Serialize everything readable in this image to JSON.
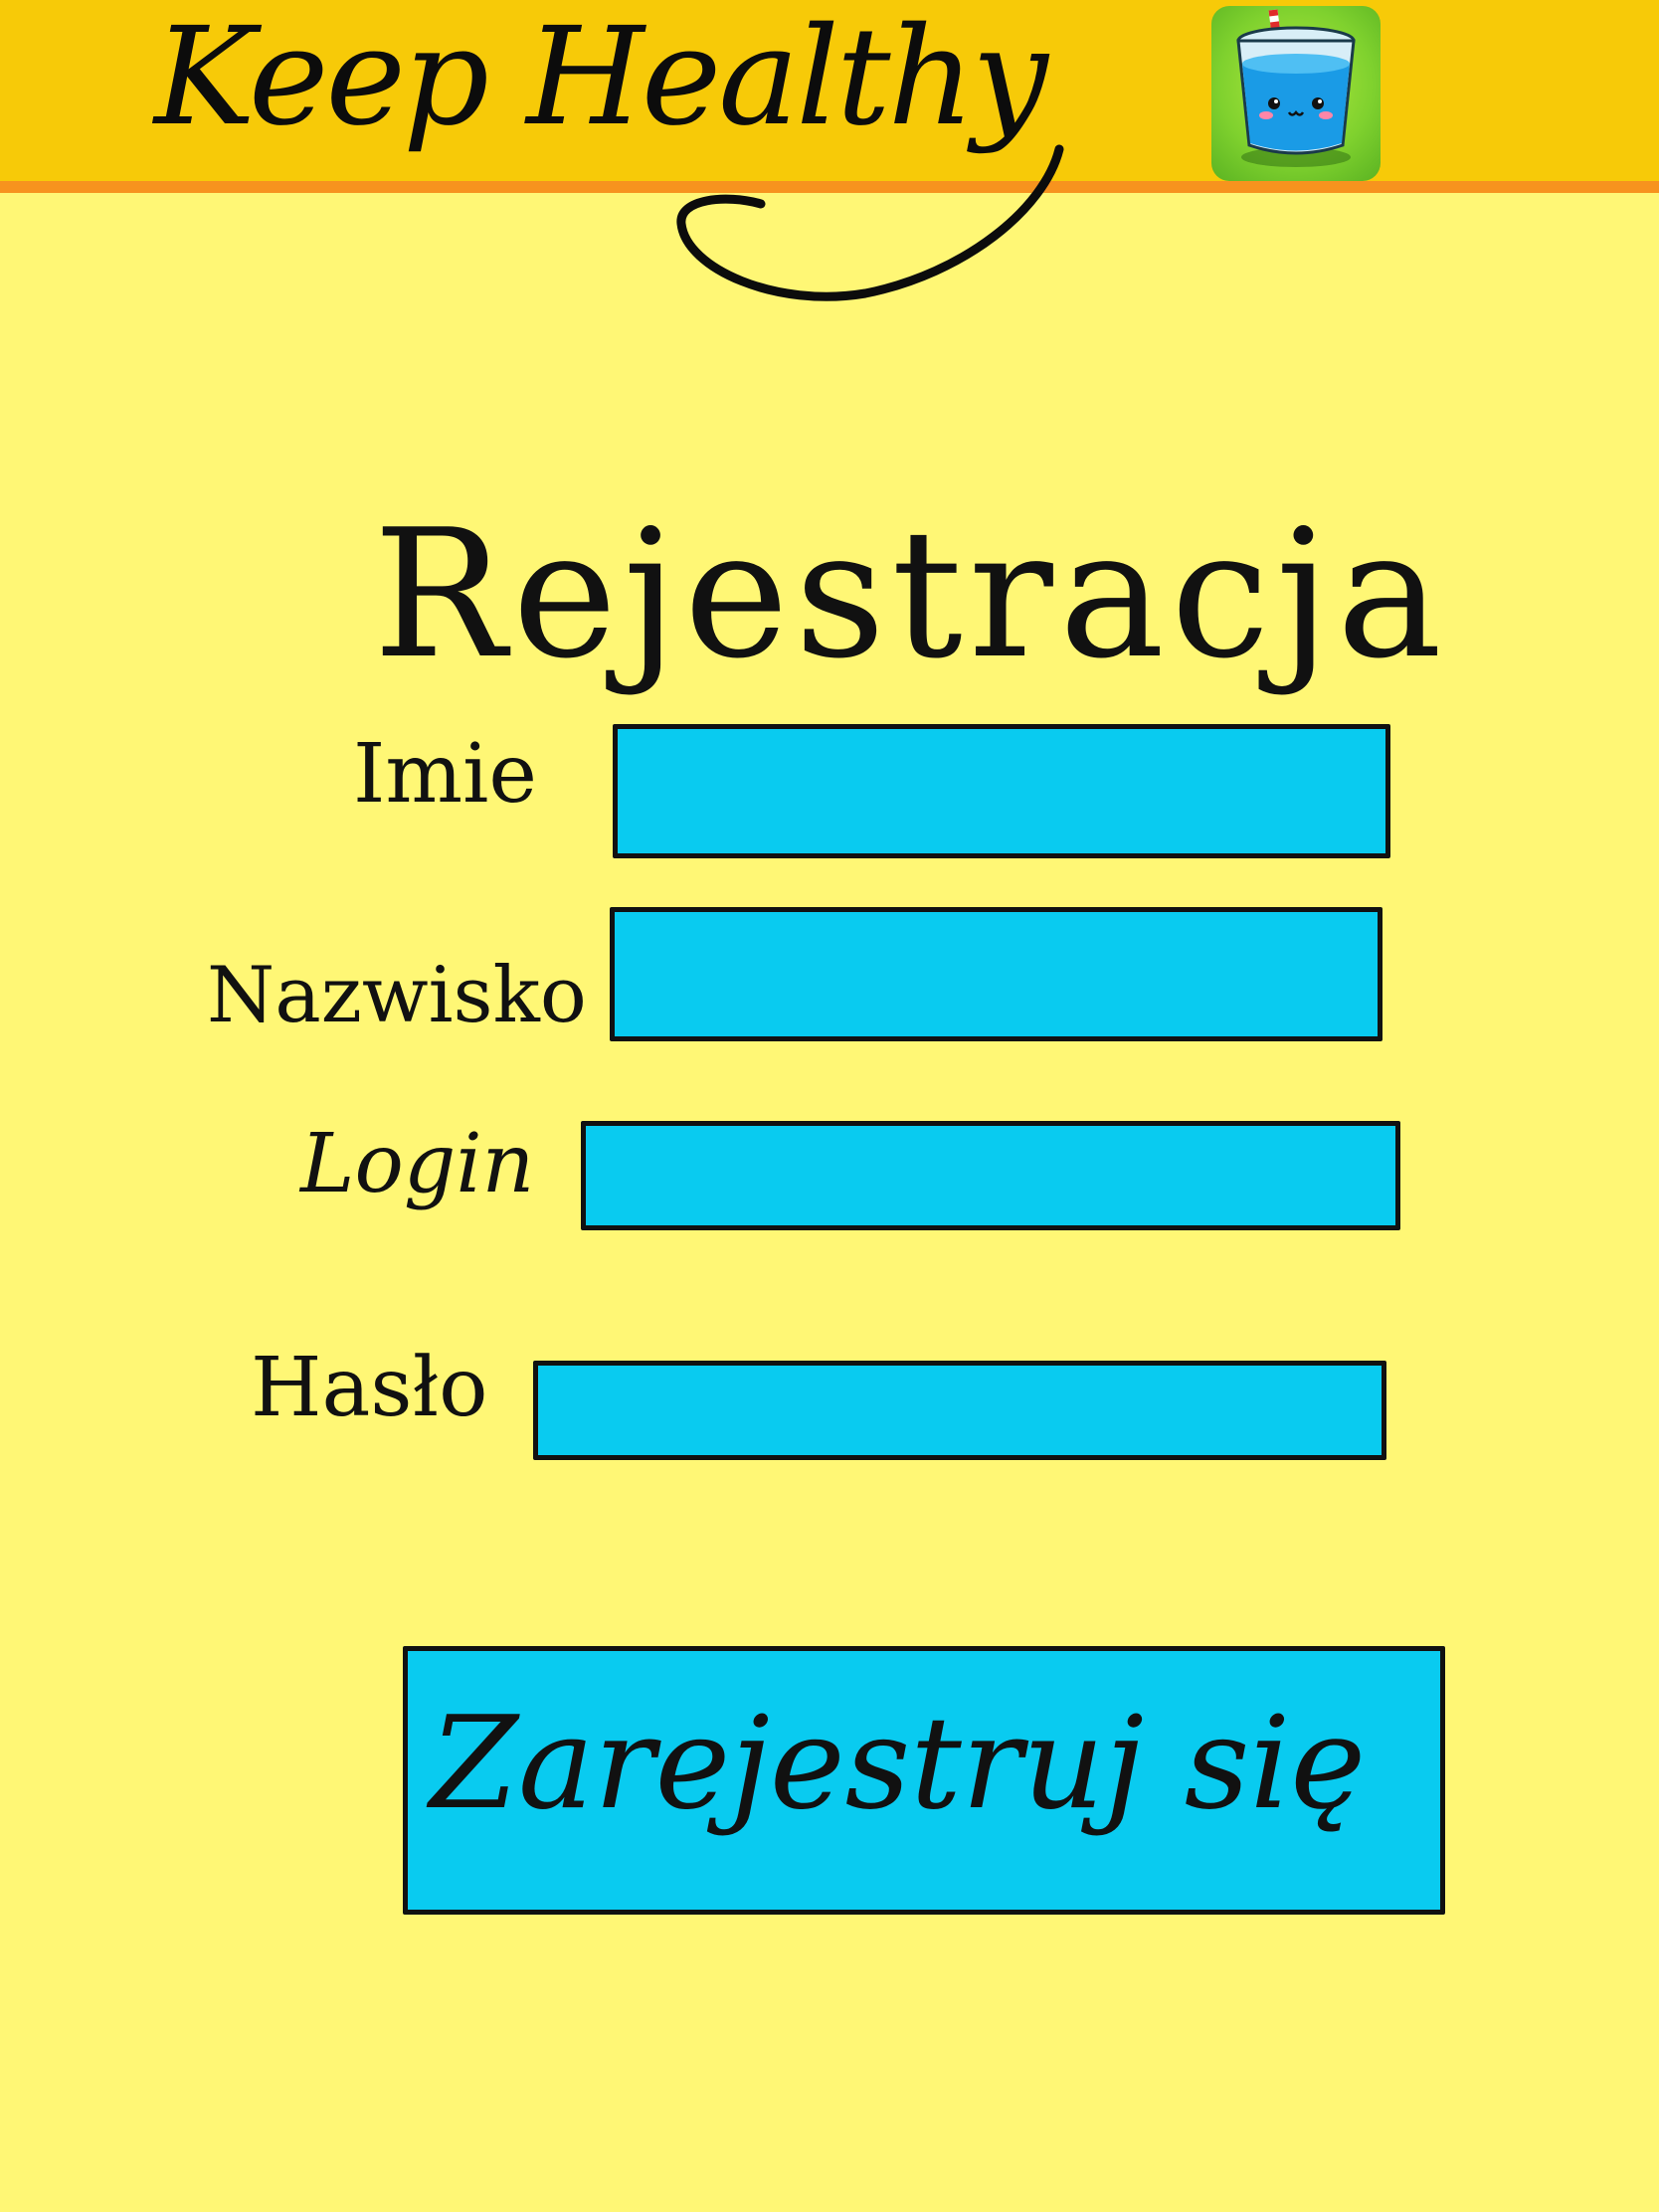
{
  "header": {
    "app_title": "Keep Healthy",
    "app_icon": "water-glass-icon",
    "colors": {
      "bar": "#f7ca08",
      "bar_underline": "#f7931e",
      "icon_background": "#7fd12e"
    }
  },
  "main": {
    "title": "Rejestracja",
    "background_color": "#fff775",
    "fields": [
      {
        "label": "Imie",
        "value": ""
      },
      {
        "label": "Nazwisko",
        "value": ""
      },
      {
        "label": "Login",
        "value": ""
      },
      {
        "label": "Hasło",
        "value": ""
      }
    ],
    "field_color": "#09cbf0",
    "submit_label": "Zarejestruj się"
  }
}
